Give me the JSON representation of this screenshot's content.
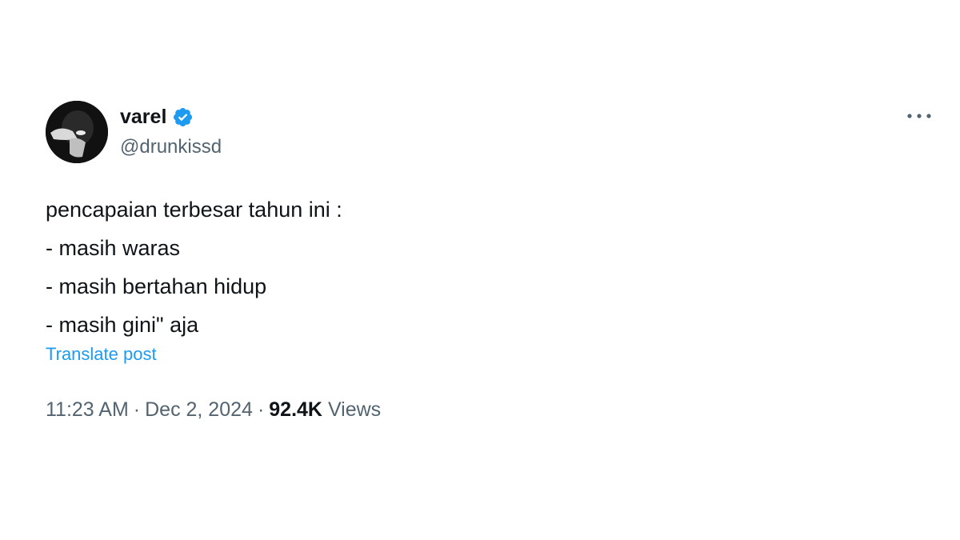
{
  "user": {
    "display_name": "varel",
    "handle": "@drunkissd",
    "verified_color": "#1d9bf0"
  },
  "post": {
    "lines": [
      "pencapaian terbesar tahun ini :",
      "- masih waras",
      "- masih bertahan hidup",
      "- masih gini\" aja"
    ],
    "translate_label": "Translate post"
  },
  "meta": {
    "time": "11:23 AM",
    "separator": "·",
    "date": "Dec 2, 2024",
    "views_count": "92.4K",
    "views_label": "Views"
  },
  "icons": {
    "more": "more-options-icon",
    "verified": "verified-badge-icon"
  },
  "colors": {
    "accent": "#1d9bf0",
    "text_primary": "#0f1419",
    "text_secondary": "#536471"
  }
}
